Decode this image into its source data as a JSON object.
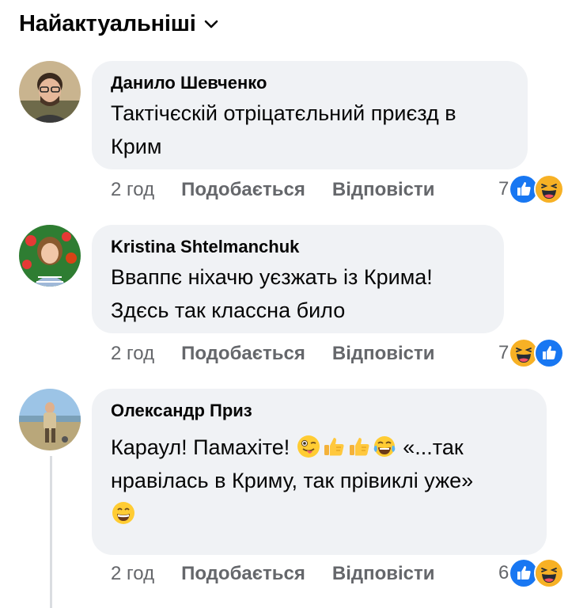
{
  "sort_label": "Найактуальніші",
  "comments": [
    {
      "author": "Данило Шевченко",
      "text": "Тактічєскій отріцатєльний приєзд в Крим",
      "line1": "Тактічєскій отріцатєльний приєзд в",
      "line2": "Крим",
      "time": "2 год",
      "like_label": "Подобається",
      "reply_label": "Відповісти",
      "reaction_count": "7",
      "reactions": [
        "like-icon",
        "haha-icon"
      ]
    },
    {
      "author": "Kristina Shtelmanchuk",
      "line1": "Вваппє ніхачю уєзжать із Крима!",
      "line2": "Здєсь так классна било",
      "time": "2 год",
      "like_label": "Подобається",
      "reply_label": "Відповісти",
      "reaction_count": "7",
      "reactions": [
        "haha-icon",
        "like-icon"
      ]
    },
    {
      "author": "Олександр Приз",
      "line1_a": "Караул! Памахіте!",
      "line1_b": "«...так",
      "line2": "нравілась в Криму, так прівиклі уже»",
      "emojis_line1": [
        "winking-tongue-emoji",
        "thumbs-up-emoji",
        "thumbs-up-emoji",
        "tears-of-joy-emoji"
      ],
      "emoji_line3": "grinning-emoji",
      "time": "2 год",
      "like_label": "Подобається",
      "reply_label": "Відповісти",
      "reaction_count": "6",
      "reactions": [
        "like-icon",
        "haha-icon"
      ]
    }
  ],
  "colors": {
    "bubble": "#f0f2f5",
    "meta": "#65676b",
    "like_blue": "#1877f2",
    "haha_yellow": "#f7b125"
  }
}
